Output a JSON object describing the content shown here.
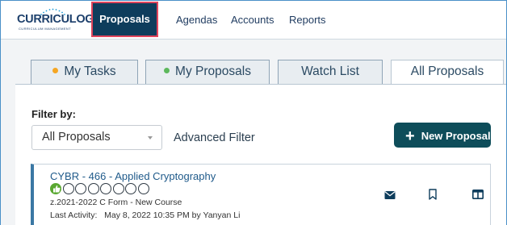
{
  "logo": {
    "name": "CURRICULOG",
    "tagline": "CURRICULUM MANAGEMENT"
  },
  "nav": {
    "items": [
      {
        "label": "Proposals",
        "active": true
      },
      {
        "label": "Agendas"
      },
      {
        "label": "Accounts"
      },
      {
        "label": "Reports"
      }
    ]
  },
  "tabs": [
    {
      "label": "My Tasks",
      "dot": "#f5a623"
    },
    {
      "label": "My Proposals",
      "dot": "#5cb85c"
    },
    {
      "label": "Watch List"
    },
    {
      "label": "All Proposals",
      "active": true
    }
  ],
  "filter": {
    "label": "Filter by:",
    "selected": "All Proposals",
    "advanced_label": "Advanced Filter"
  },
  "new_proposal_label": "New Proposal",
  "proposal": {
    "title": "CYBR - 466 - Applied Cryptography",
    "stages_completed": 1,
    "stages_total": 8,
    "form": "z.2021-2022 C Form - New Course",
    "activity": "Last Activity:   May 8, 2022 10:35 PM by Yanyan Li",
    "icons": [
      "envelope-icon",
      "bookmark-icon",
      "columns-icon"
    ]
  },
  "colors": {
    "nav_active_bg": "#0e3d5c",
    "highlight_border": "#e0455c",
    "new_button_bg": "#0e4d5a",
    "card_accent": "#3b78a4",
    "stage_done": "#5aa832"
  }
}
